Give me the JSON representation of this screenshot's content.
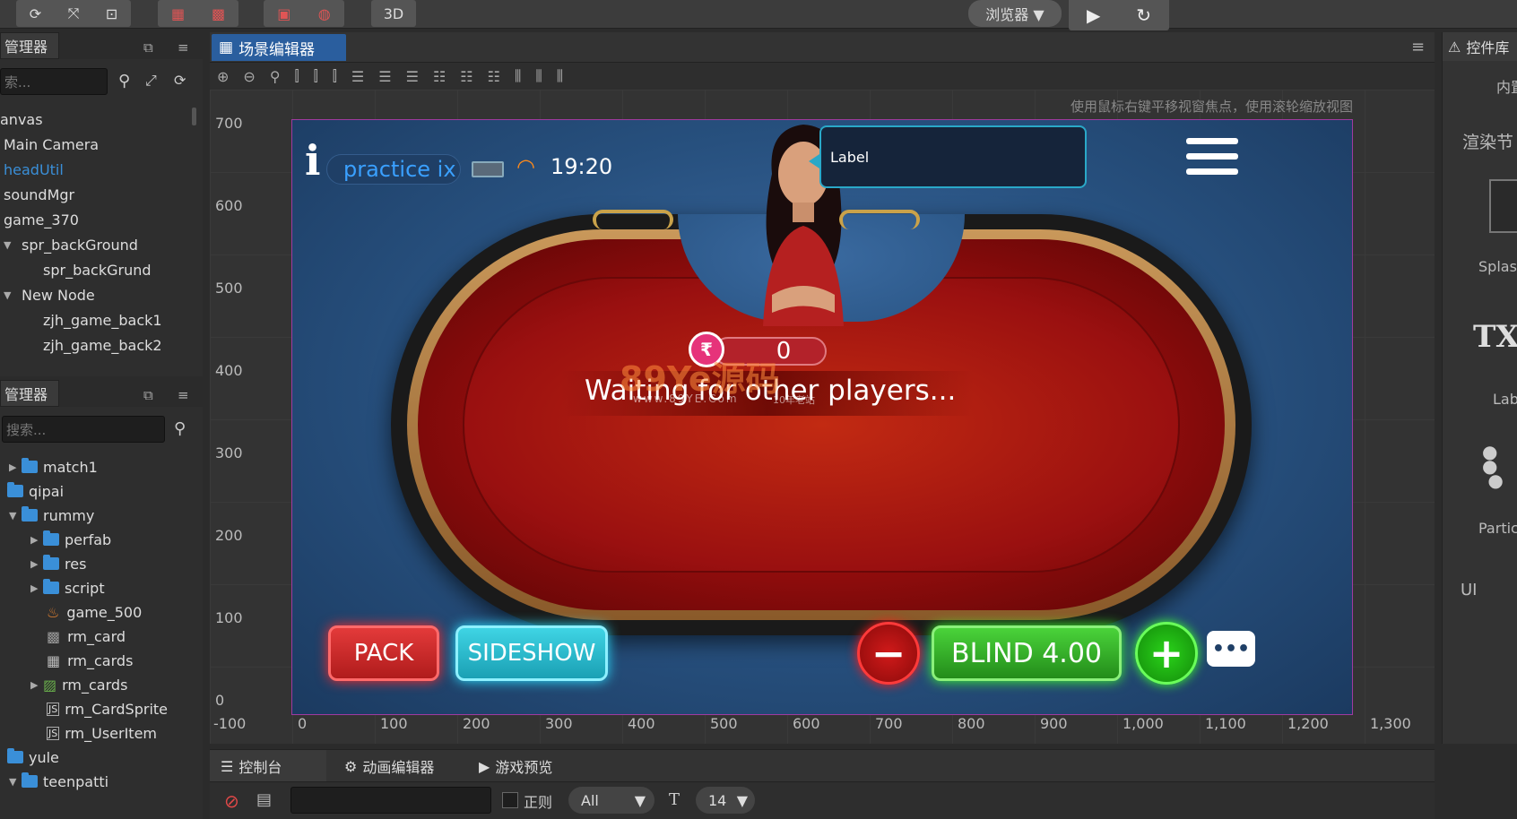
{
  "topbar": {
    "browser_label": "浏览器 ▼",
    "mode_3d": "3D",
    "icons": [
      "refresh-icon",
      "expand-icon",
      "fit-icon",
      "layout-icon-1",
      "layout-icon-2",
      "screen-icon",
      "globe-icon",
      "play-icon",
      "reload-icon"
    ]
  },
  "hierarchy": {
    "title": "管理器",
    "search_placeholder": "索...",
    "items": [
      "anvas",
      "Main Camera",
      "headUtil",
      "soundMgr",
      "game_370",
      "spr_backGround",
      "spr_backGrund",
      "New Node",
      "zjh_game_back1",
      "zjh_game_back2"
    ]
  },
  "assets": {
    "title": "管理器",
    "search_placeholder": "搜索...",
    "items": [
      "match1",
      "qipai",
      "rummy",
      "perfab",
      "res",
      "script",
      "game_500",
      "rm_card",
      "rm_cards",
      "rm_cards",
      "rm_CardSprite",
      "rm_UserItem",
      "yule",
      "teenpatti"
    ]
  },
  "scene": {
    "tab_label": "场景编辑器",
    "hint": "使用鼠标右键平移视窗焦点，使用滚轮缩放视图",
    "y_ticks": [
      "700",
      "600",
      "500",
      "400",
      "300",
      "200",
      "100",
      "0"
    ],
    "x_ticks": [
      "-100",
      "0",
      "100",
      "200",
      "300",
      "400",
      "500",
      "600",
      "700",
      "800",
      "900",
      "1,000",
      "1,100",
      "1,200",
      "1,300"
    ]
  },
  "game": {
    "info_icon": "i",
    "room_name": "practice ix",
    "time": "19:20",
    "speech_label": "Label",
    "pot_value": "0",
    "status_text": "Waiting for other players...",
    "watermark_main": "89Ye源码",
    "watermark_sub": "www.89YE.Com",
    "watermark_note": "10年老站",
    "pack_label": "PACK",
    "sideshow_label": "SIDESHOW",
    "blind_label": "BLIND 4.00",
    "minus_label": "−",
    "plus_label": "+",
    "chat_label": "•••"
  },
  "right_panel": {
    "title": "控件库",
    "items": [
      "内置",
      "渲染节",
      "Splas",
      "TX",
      "Lab",
      "Partic",
      "UI"
    ]
  },
  "bottom": {
    "tabs": [
      "控制台",
      "动画编辑器",
      "游戏预览"
    ],
    "regex_label": "正则",
    "filter_value": "All",
    "font_size_value": "14"
  },
  "colors": {
    "accent": "#3a8fd8",
    "pack": "#d8252b",
    "sideshow": "#2ec4d6",
    "blind": "#3cbf2c",
    "selection": "#1e6fd6"
  }
}
